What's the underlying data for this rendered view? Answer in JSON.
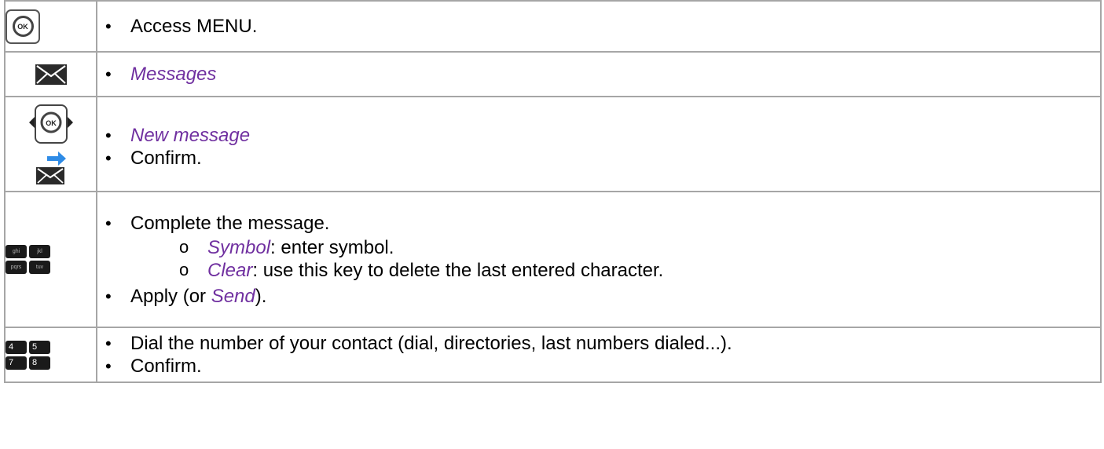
{
  "rows": [
    {
      "icons": [
        "ok-button-icon"
      ],
      "items": [
        {
          "text": "Access MENU."
        }
      ]
    },
    {
      "icons": [
        "envelope-icon"
      ],
      "items": [
        {
          "kw": "Messages"
        }
      ]
    },
    {
      "icons": [
        "ok-navigation-icon",
        "envelope-arrow-icon"
      ],
      "items": [
        {
          "kw": "New message"
        },
        {
          "text": "Confirm."
        }
      ]
    },
    {
      "icons": [
        "alpha-keypad-icon"
      ],
      "items": [
        {
          "text": "Complete the message."
        },
        {
          "kw": "Symbol",
          "text": ": enter symbol."
        },
        {
          "kw": "Clear",
          "text": ": use this key to delete the last entered character."
        },
        {
          "text_before": "Apply (or ",
          "kw": "Send",
          "text_after": ")."
        }
      ]
    },
    {
      "icons": [
        "numeric-keypad-icon"
      ],
      "items": [
        {
          "text": "Dial the number of your contact (dial, directories, last numbers dialed...)."
        },
        {
          "text": "Confirm."
        }
      ]
    }
  ],
  "keypad_alpha": [
    "ghi",
    "jkl",
    "pqrs",
    "tuv"
  ],
  "keypad_numeric": [
    "4",
    "5",
    "7",
    "8"
  ],
  "ok_label": "OK",
  "colors": {
    "keyword": "#7030a0",
    "arrow": "#2e8be6",
    "border": "#a6a6a6"
  }
}
